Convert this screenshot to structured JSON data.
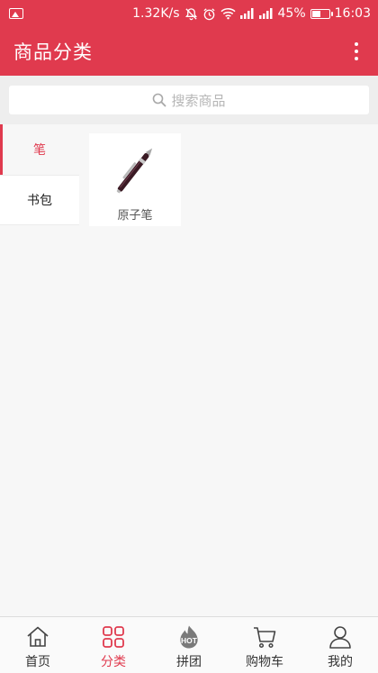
{
  "status_bar": {
    "speed": "1.32K/s",
    "battery_percent": "45%",
    "battery_level": 0.45,
    "time": "16:03"
  },
  "header": {
    "title": "商品分类"
  },
  "search": {
    "placeholder": "搜索商品"
  },
  "sidebar": {
    "items": [
      {
        "label": "笔",
        "active": true
      },
      {
        "label": "书包",
        "active": false
      }
    ]
  },
  "products": [
    {
      "name": "原子笔",
      "icon": "pen-icon"
    }
  ],
  "bottom_nav": {
    "items": [
      {
        "label": "首页",
        "icon": "home-icon",
        "active": false
      },
      {
        "label": "分类",
        "icon": "grid-icon",
        "active": true
      },
      {
        "label": "拼团",
        "icon": "hot-icon",
        "active": false
      },
      {
        "label": "购物车",
        "icon": "cart-icon",
        "active": false
      },
      {
        "label": "我的",
        "icon": "user-icon",
        "active": false
      }
    ]
  },
  "colors": {
    "accent": "#e03a4e",
    "background": "#f7f7f7"
  }
}
